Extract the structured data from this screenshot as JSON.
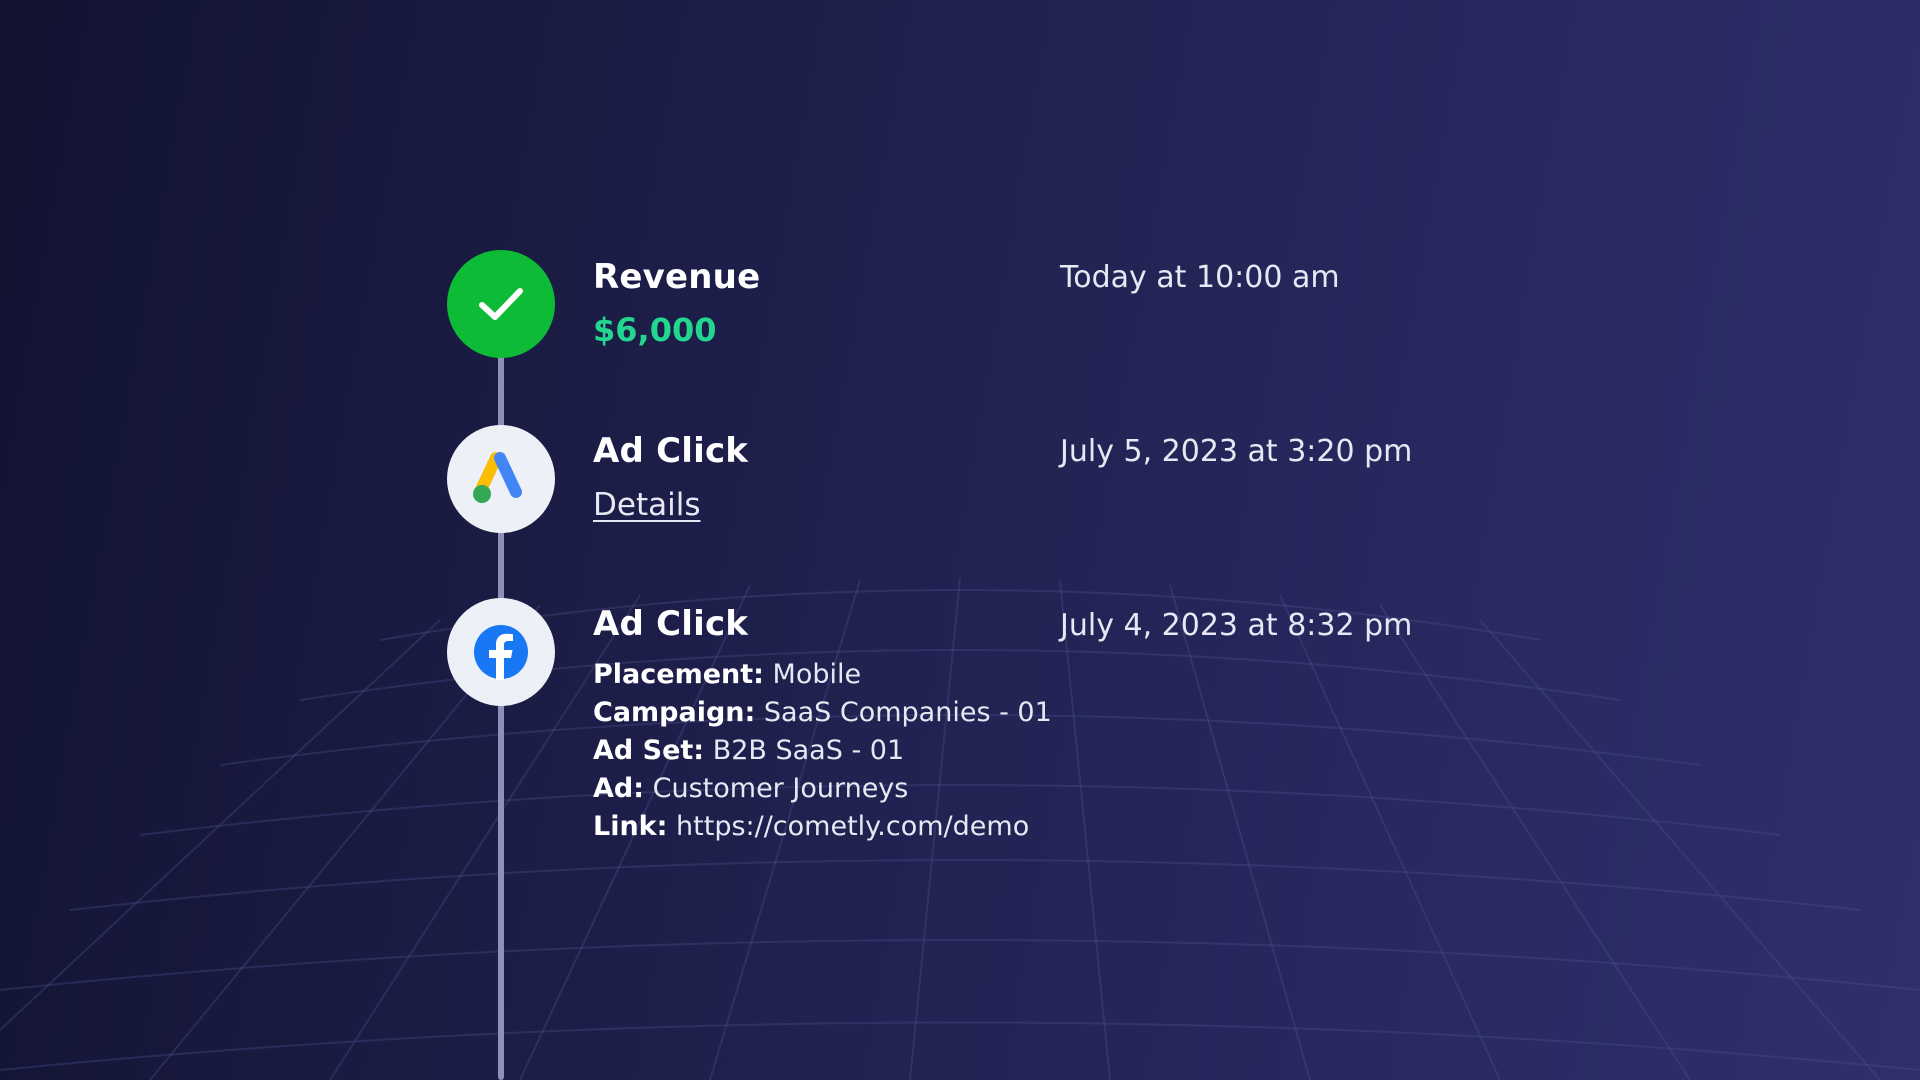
{
  "timeline": {
    "events": [
      {
        "icon": "check-icon",
        "title": "Revenue",
        "amount": "$6,000",
        "time": "Today at 10:00 am",
        "color": "#0dbb37",
        "amount_color": "#23d68f"
      },
      {
        "icon": "google-ads-icon",
        "title": "Ad Click",
        "link_text": "Details",
        "time": "July 5, 2023 at 3:20 pm"
      },
      {
        "icon": "facebook-icon",
        "title": "Ad Click",
        "time": "July 4, 2023 at 8:32 pm",
        "details": [
          {
            "label": "Placement:",
            "value": "Mobile"
          },
          {
            "label": "Campaign:",
            "value": "SaaS Companies - 01"
          },
          {
            "label": "Ad Set:",
            "value": "B2B SaaS - 01"
          },
          {
            "label": "Ad:",
            "value": "Customer Journeys"
          },
          {
            "label": "Link:",
            "value": "https://cometly.com/demo"
          }
        ]
      }
    ]
  }
}
